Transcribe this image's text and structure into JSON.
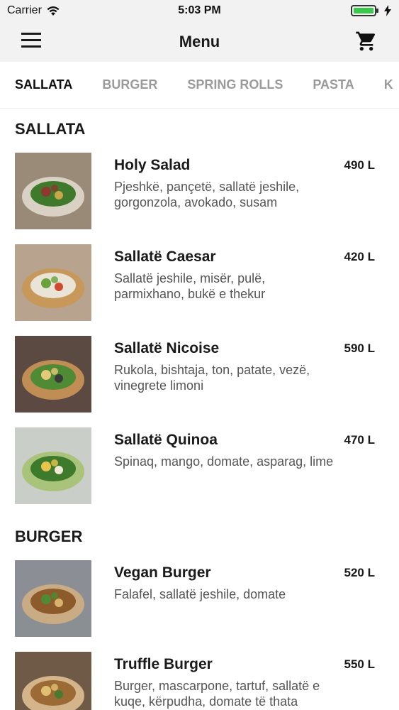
{
  "status": {
    "carrier": "Carrier",
    "time": "5:03 PM",
    "battery_level": 1.0
  },
  "nav": {
    "title": "Menu",
    "menu_icon": "hamburger-icon",
    "cart_icon": "cart-icon"
  },
  "tabs": [
    {
      "label": "SALLATA",
      "active": true
    },
    {
      "label": "BURGER",
      "active": false
    },
    {
      "label": "SPRING ROLLS",
      "active": false
    },
    {
      "label": "PASTA",
      "active": false
    },
    {
      "label": "K",
      "active": false
    }
  ],
  "sections": [
    {
      "title": "SALLATA",
      "items": [
        {
          "name": "Holy Salad",
          "desc": "Pjeshkë, pançetë, sallatë jeshile, gorgonzola, avokado, susam",
          "price": "490 L"
        },
        {
          "name": "Sallatë Caesar",
          "desc": "Sallatë jeshile, misër, pulë, parmixhano, bukë e thekur",
          "price": "420 L"
        },
        {
          "name": "Sallatë Nicoise",
          "desc": "Rukola, bishtaja, ton, patate, vezë, vinegrete limoni",
          "price": "590 L"
        },
        {
          "name": "Sallatë Quinoa",
          "desc": "Spinaq, mango, domate, asparag, lime",
          "price": "470 L"
        }
      ]
    },
    {
      "title": "BURGER",
      "items": [
        {
          "name": "Vegan Burger",
          "desc": "Falafel, sallatë jeshile, domate",
          "price": "520 L"
        },
        {
          "name": "Truffle Burger",
          "desc": "Burger, mascarpone, tartuf, sallatë e kuqe, kërpudha, domate të thata",
          "price": "550 L"
        }
      ]
    }
  ],
  "colors": {
    "bar_bg": "#f2f2f2",
    "inactive_tab": "#9a9a9a",
    "battery": "#3ac94b"
  }
}
